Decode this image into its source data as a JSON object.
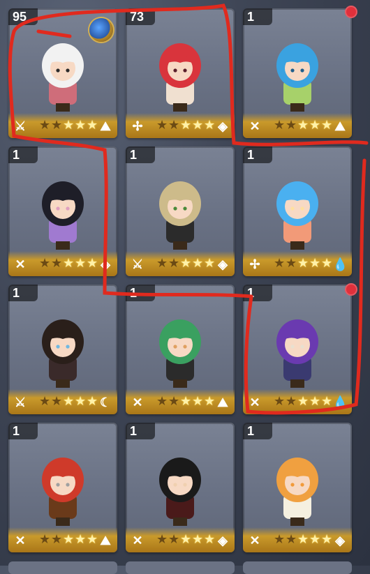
{
  "inventory": {
    "cards": [
      {
        "level": "95",
        "left_icon": "swords",
        "right_icon": "mountain",
        "stars": 5,
        "lit": 3,
        "art": {
          "hair": "#f2f2f2",
          "outfit": "#cf6d7a",
          "accent": "#2b2b2b"
        }
      },
      {
        "level": "73",
        "left_icon": "staff",
        "right_icon": "diamond",
        "stars": 5,
        "lit": 3,
        "art": {
          "hair": "#d9343c",
          "outfit": "#f0e0d0",
          "accent": "#5a1f2b"
        }
      },
      {
        "level": "1",
        "left_icon": "bow",
        "right_icon": "mountain",
        "stars": 5,
        "lit": 3,
        "art": {
          "hair": "#3aa2e0",
          "outfit": "#a7d16a",
          "accent": "#1f5f8c"
        }
      },
      {
        "level": "1",
        "left_icon": "bow",
        "right_icon": "diamond",
        "stars": 5,
        "lit": 3,
        "art": {
          "hair": "#1e1e28",
          "outfit": "#a07ad0",
          "accent": "#e0a0c0"
        }
      },
      {
        "level": "1",
        "left_icon": "swords",
        "right_icon": "diamond",
        "stars": 5,
        "lit": 3,
        "art": {
          "hair": "#cdbb8a",
          "outfit": "#2b2b2b",
          "accent": "#4a8a3a"
        }
      },
      {
        "level": "1",
        "left_icon": "staff",
        "right_icon": "drop",
        "stars": 5,
        "lit": 3,
        "art": {
          "hair": "#4ab0f0",
          "outfit": "#f29a78",
          "accent": "#ffe0a0"
        }
      },
      {
        "level": "1",
        "left_icon": "swords",
        "right_icon": "moon",
        "stars": 5,
        "lit": 3,
        "art": {
          "hair": "#2a1f1a",
          "outfit": "#3a2a2a",
          "accent": "#70b8e0"
        }
      },
      {
        "level": "1",
        "left_icon": "bow",
        "right_icon": "mountain",
        "stars": 5,
        "lit": 3,
        "art": {
          "hair": "#3aa060",
          "outfit": "#2b2b2b",
          "accent": "#e0a060"
        }
      },
      {
        "level": "1",
        "left_icon": "bow",
        "right_icon": "drop",
        "stars": 5,
        "lit": 3,
        "art": {
          "hair": "#6a3ab0",
          "outfit": "#3a3a70",
          "accent": "#e8e0d0"
        }
      },
      {
        "level": "1",
        "left_icon": "bow",
        "right_icon": "mountain",
        "stars": 5,
        "lit": 3,
        "art": {
          "hair": "#cf3a2a",
          "outfit": "#6a3a1a",
          "accent": "#a0a0a0"
        }
      },
      {
        "level": "1",
        "left_icon": "bow",
        "right_icon": "diamond",
        "stars": 5,
        "lit": 3,
        "art": {
          "hair": "#1a1a1a",
          "outfit": "#4a1a1a",
          "accent": "#f0d0b0"
        }
      },
      {
        "level": "1",
        "left_icon": "bow",
        "right_icon": "diamond",
        "stars": 5,
        "lit": 3,
        "art": {
          "hair": "#f0a040",
          "outfit": "#f5f0e0",
          "accent": "#f29a3a"
        }
      }
    ],
    "notifications": [
      "card-3",
      "card-9"
    ]
  }
}
